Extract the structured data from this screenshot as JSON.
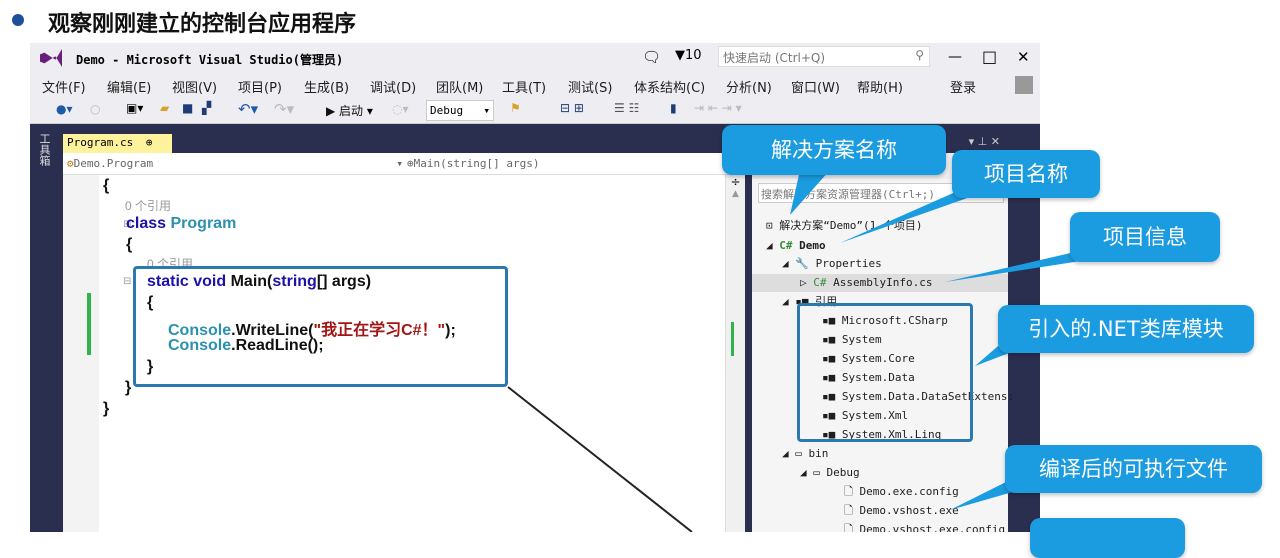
{
  "slide": {
    "title": "观察刚刚建立的控制台应用程序"
  },
  "window": {
    "title": "Demo - Microsoft Visual Studio(管理员)",
    "notifications": "10",
    "quick_launch_placeholder": "快速启动 (Ctrl+Q)",
    "minimize": "—",
    "maximize": "□",
    "close": "✕"
  },
  "menu": [
    "文件(F)",
    "编辑(E)",
    "视图(V)",
    "项目(P)",
    "生成(B)",
    "调试(D)",
    "团队(M)",
    "工具(T)",
    "测试(S)",
    "体系结构(C)",
    "分析(N)",
    "窗口(W)",
    "帮助(H)"
  ],
  "signin": "登录",
  "toolbar": {
    "start": "▶ 启动",
    "config": "Debug"
  },
  "side_strip": "工具箱",
  "editor": {
    "tab": "Program.cs",
    "tab_pin": "⊕",
    "tab_close": "✕",
    "nav_class": "Demo.Program",
    "nav_member": "Main(string[] args)",
    "refs": "0 个引用",
    "class_kw": "class",
    "class_name": "Program",
    "open": "{",
    "close": "}",
    "static_kw": "static void",
    "main": "Main(",
    "string_kw": "string",
    "args": "[] args)",
    "console": "Console",
    "writeline": ".WriteLine(",
    "str": "\"我正在学习C#！\"",
    "end": ");",
    "readline": ".ReadLine();"
  },
  "solution_explorer": {
    "search_placeholder": "搜索解决方案资源管理器(Ctrl+;)",
    "items": [
      "解决方案“Demo”(1 个项目)",
      "Demo",
      "Properties",
      "AssemblyInfo.cs",
      "引用",
      "Microsoft.CSharp",
      "System",
      "System.Core",
      "System.Data",
      "System.Data.DataSetExtens:",
      "System.Xml",
      "System.Xml.Linq",
      "bin",
      "Debug",
      "Demo.exe.config",
      "Demo.vshost.exe",
      "Demo.vshost.exe.config"
    ]
  },
  "callouts": [
    "解决方案名称",
    "项目名称",
    "项目信息",
    "引入的.NET类库模块",
    "编译后的可执行文件"
  ],
  "colors": {
    "callout": "#1b9be0",
    "vs_dark": "#2b2f4f",
    "tab_active": "#fff29d"
  }
}
